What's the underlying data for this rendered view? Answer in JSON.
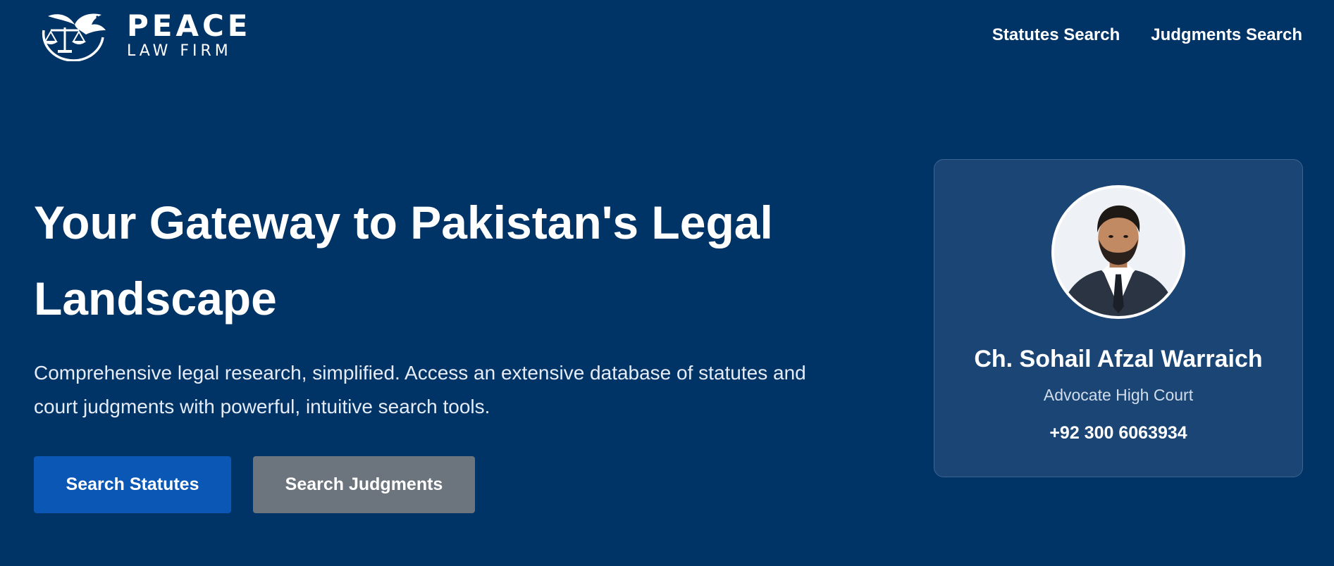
{
  "brand": {
    "title": "PEACE",
    "subtitle": "LAW FIRM",
    "logo_icon": "dove-scales-icon"
  },
  "nav": {
    "items": [
      {
        "label": "Statutes Search"
      },
      {
        "label": "Judgments Search"
      }
    ]
  },
  "hero": {
    "title": "Your Gateway to Pakistan's Legal Landscape",
    "description": "Comprehensive legal research, simplified. Access an extensive database of statutes and court judgments with powerful, intuitive search tools.",
    "primary_button": "Search Statutes",
    "secondary_button": "Search Judgments"
  },
  "profile": {
    "name": "Ch. Sohail Afzal Warraich",
    "role": "Advocate High Court",
    "phone": "+92 300 6063934",
    "photo_icon": "person-portrait-icon"
  },
  "colors": {
    "background": "#003366",
    "card": "#1a4574",
    "primary_button": "#0b57b5",
    "secondary_button": "#6c757d"
  }
}
